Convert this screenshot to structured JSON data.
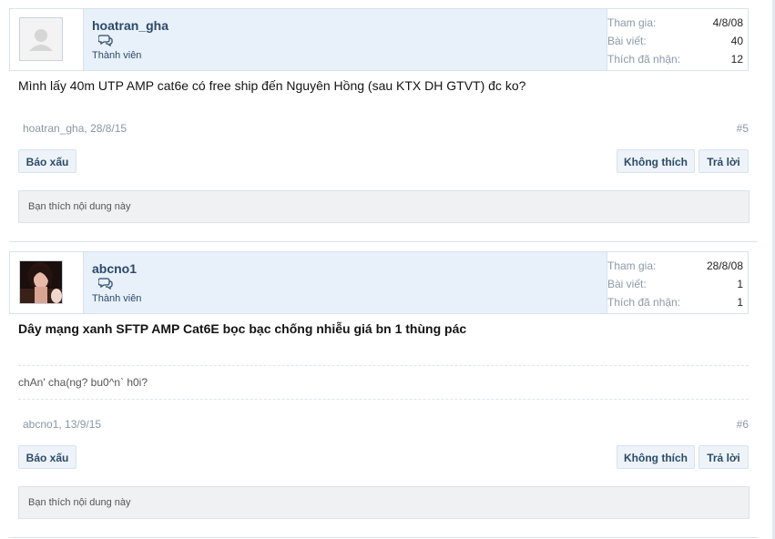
{
  "posts": [
    {
      "username": "hoatran_gha",
      "user_title": "Thành viên",
      "avatar": "default-avatar",
      "stats": {
        "join_label": "Tham gia:",
        "join_value": "4/8/08",
        "posts_label": "Bài viết:",
        "posts_value": "40",
        "likes_label": "Thích đã nhận:",
        "likes_value": "12"
      },
      "message": "Mình lấy 40m UTP AMP cat6e có free ship đến Nguyên Hồng (sau KTX DH GTVT) đc ko?",
      "signature": "",
      "meta": "hoatran_gha, 28/8/15",
      "post_number": "#5",
      "report_label": "Báo xấu",
      "unlike_label": "Không thích",
      "reply_label": "Trả lời",
      "likes_text": "Bạn thích nội dung này"
    },
    {
      "username": "abcno1",
      "user_title": "Thành viên",
      "avatar": "user-photo",
      "stats": {
        "join_label": "Tham gia:",
        "join_value": "28/8/08",
        "posts_label": "Bài viết:",
        "posts_value": "1",
        "likes_label": "Thích đã nhận:",
        "likes_value": "1"
      },
      "message": "Dây mạng xanh SFTP AMP Cat6E bọc bạc chống nhiễu giá bn 1 thùng pác",
      "signature": "chAn' cha(ng? bu0^n` h0i?",
      "meta": "abcno1, 13/9/15",
      "post_number": "#6",
      "report_label": "Báo xấu",
      "unlike_label": "Không thích",
      "reply_label": "Trả lời",
      "likes_text": "Bạn thích nội dung này"
    }
  ],
  "icons": {
    "message": "conversation-icon"
  },
  "colors": {
    "username": "#2b4a69",
    "userbar_bg": "#e8f0fa",
    "button_bg": "#eef3f9"
  }
}
